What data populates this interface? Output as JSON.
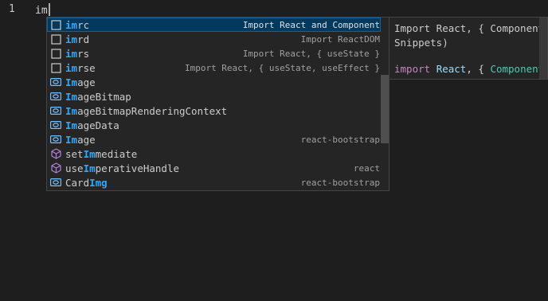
{
  "editor": {
    "line_number": "1",
    "typed_text": "im"
  },
  "suggestions": [
    {
      "pre": "",
      "hl": "im",
      "post": "rc",
      "detail": "Import React and Component",
      "icon": "snippet-icon",
      "selected": true
    },
    {
      "pre": "",
      "hl": "im",
      "post": "rd",
      "detail": "Import ReactDOM",
      "icon": "snippet-icon"
    },
    {
      "pre": "",
      "hl": "im",
      "post": "rs",
      "detail": "Import React, { useState }",
      "icon": "snippet-icon"
    },
    {
      "pre": "",
      "hl": "im",
      "post": "rse",
      "detail": "Import React, { useState, useEffect }",
      "icon": "snippet-icon"
    },
    {
      "pre": "",
      "hl": "Im",
      "post": "age",
      "detail": "",
      "icon": "variable-icon"
    },
    {
      "pre": "",
      "hl": "Im",
      "post": "ageBitmap",
      "detail": "",
      "icon": "variable-icon"
    },
    {
      "pre": "",
      "hl": "Im",
      "post": "ageBitmapRenderingContext",
      "detail": "",
      "icon": "variable-icon"
    },
    {
      "pre": "",
      "hl": "Im",
      "post": "ageData",
      "detail": "",
      "icon": "variable-icon"
    },
    {
      "pre": "",
      "hl": "Im",
      "post": "age",
      "detail": "react-bootstrap",
      "icon": "variable-icon"
    },
    {
      "pre": "set",
      "hl": "Im",
      "post": "mediate",
      "detail": "",
      "icon": "method-icon"
    },
    {
      "pre": "use",
      "hl": "Im",
      "post": "perativeHandle",
      "detail": "react",
      "icon": "method-icon"
    },
    {
      "pre": "Card",
      "hl": "Img",
      "post": "",
      "detail": "react-bootstrap",
      "icon": "variable-icon"
    }
  ],
  "docs": {
    "detail": "Import React, { Component }\nSnippets)",
    "code": {
      "kw": "import",
      "name": "React",
      "sep": ", { ",
      "cls": "Component",
      "end": " }"
    }
  },
  "colors": {
    "highlight": "#2aaaff",
    "selected_bg": "#04395e",
    "variable_icon": "#75beff",
    "method_icon": "#b180d7"
  }
}
